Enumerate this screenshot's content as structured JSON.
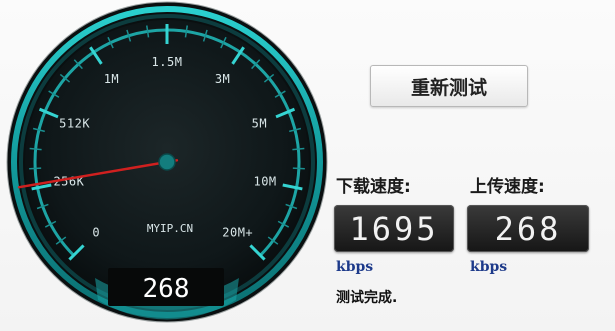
{
  "gauge": {
    "tick_labels": [
      "0",
      "256K",
      "512K",
      "1M",
      "1.5M",
      "3M",
      "5M",
      "10M",
      "20M+"
    ],
    "site_label": "MYIP.CN",
    "readout": "268",
    "needle_value_kbps": 268
  },
  "controls": {
    "retest_label": "重新测试"
  },
  "results": {
    "download_label": "下载速度:",
    "download_value": "1695",
    "download_unit": "kbps",
    "upload_label": "上传速度:",
    "upload_value": "268",
    "upload_unit": "kbps",
    "status": "测试完成."
  },
  "colors": {
    "accent_teal": "#1fb5b5",
    "needle_red": "#d0201f",
    "dial_face": "#0e1516"
  }
}
